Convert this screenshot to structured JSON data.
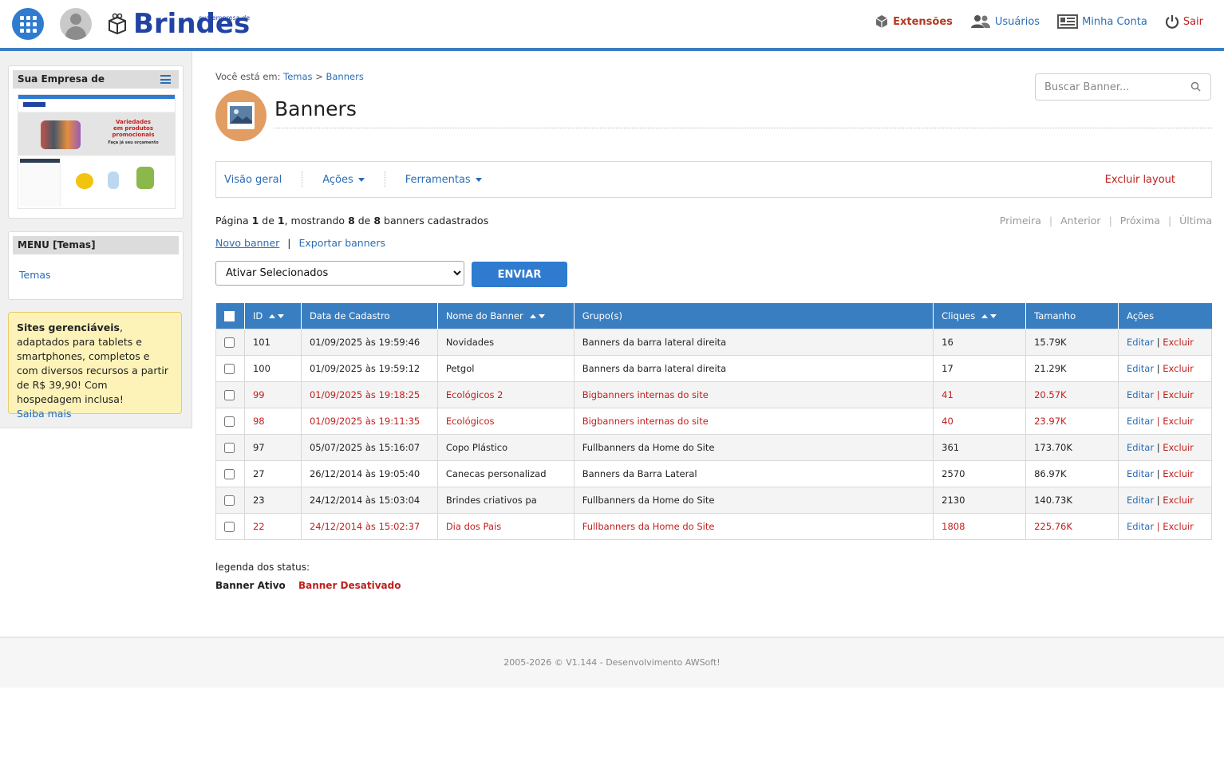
{
  "header": {
    "brand": "Brindes",
    "brand_tag": "sua empresa de",
    "nav": [
      {
        "label": "Extensões",
        "icon": "cube-icon"
      },
      {
        "label": "Usuários",
        "icon": "users-icon"
      },
      {
        "label": "Minha Conta",
        "icon": "account-icon"
      },
      {
        "label": "Sair",
        "icon": "power-icon"
      }
    ]
  },
  "sidebar": {
    "site_panel_title": "Sua Empresa de",
    "thumb": {
      "headline_1": "Variedades",
      "headline_2": "em produtos",
      "headline_3": "promocionais",
      "subline": "Faça já seu orçamento"
    },
    "menu_title": "MENU [Temas]",
    "menu_items": [
      "Temas"
    ],
    "promo": {
      "bold": "Sites gerenciáveis",
      "text": ", adaptados para tablets e smartphones, completos e com diversos recursos a partir de R$ 39,90! Com hospedagem inclusa!",
      "link": "Saiba mais"
    }
  },
  "breadcrumb": {
    "prefix": "Você está em:",
    "items": [
      "Temas",
      "Banners"
    ],
    "separator": ">"
  },
  "page": {
    "title": "Banners",
    "search_placeholder": "Buscar Banner..."
  },
  "tabs": {
    "overview": "Visão geral",
    "actions": "Ações",
    "tools": "Ferramentas",
    "delete_layout": "Excluir layout"
  },
  "pageinfo": {
    "t1": "Página ",
    "page": "1",
    "t2": " de ",
    "pages": "1",
    "t3": ", mostrando ",
    "shown": "8",
    "t4": " de ",
    "total": "8",
    "t5": " banners cadastrados"
  },
  "pager": [
    "Primeira",
    "Anterior",
    "Próxima",
    "Última"
  ],
  "links": {
    "new": "Novo banner",
    "export": "Exportar banners",
    "sep": "|"
  },
  "bulk": {
    "selected": "Ativar Selecionados",
    "send": "ENVIAR"
  },
  "table": {
    "columns": [
      "ID",
      "Data de Cadastro",
      "Nome do Banner",
      "Grupo(s)",
      "Cliques",
      "Tamanho",
      "Ações"
    ],
    "edit_label": "Editar",
    "delete_label": "Excluir",
    "rows": [
      {
        "id": "101",
        "date": "01/09/2025 às 19:59:46",
        "name": "Novidades",
        "group": "Banners da barra lateral direita",
        "clicks": "16",
        "size": "15.79K",
        "active": true
      },
      {
        "id": "100",
        "date": "01/09/2025 às 19:59:12",
        "name": "Petgol",
        "group": "Banners da barra lateral direita",
        "clicks": "17",
        "size": "21.29K",
        "active": true
      },
      {
        "id": "99",
        "date": "01/09/2025 às 19:18:25",
        "name": "Ecológicos 2",
        "group": "Bigbanners internas do site",
        "clicks": "41",
        "size": "20.57K",
        "active": false
      },
      {
        "id": "98",
        "date": "01/09/2025 às 19:11:35",
        "name": "Ecológicos",
        "group": "Bigbanners internas do site",
        "clicks": "40",
        "size": "23.97K",
        "active": false
      },
      {
        "id": "97",
        "date": "05/07/2025 às 15:16:07",
        "name": "Copo Plástico",
        "group": "Fullbanners da Home do Site",
        "clicks": "361",
        "size": "173.70K",
        "active": true
      },
      {
        "id": "27",
        "date": "26/12/2014 às 19:05:40",
        "name": "Canecas personalizad",
        "group": "Banners da Barra Lateral",
        "clicks": "2570",
        "size": "86.97K",
        "active": true
      },
      {
        "id": "23",
        "date": "24/12/2014 às 15:03:04",
        "name": "Brindes criativos pa",
        "group": "Fullbanners da Home do Site",
        "clicks": "2130",
        "size": "140.73K",
        "active": true
      },
      {
        "id": "22",
        "date": "24/12/2014 às 15:02:37",
        "name": "Dia dos Pais",
        "group": "Fullbanners da Home do Site",
        "clicks": "1808",
        "size": "225.76K",
        "active": false
      }
    ]
  },
  "legend": {
    "title": "legenda dos status:",
    "active": "Banner Ativo",
    "inactive": "Banner Desativado"
  },
  "footer": "2005-2026 © V1.144 - Desenvolvimento AWSoft!",
  "colors": {
    "primary": "#3a7ec2",
    "danger": "#c0201e",
    "brand": "#2143a4",
    "promo_bg": "#fdf3b9"
  }
}
